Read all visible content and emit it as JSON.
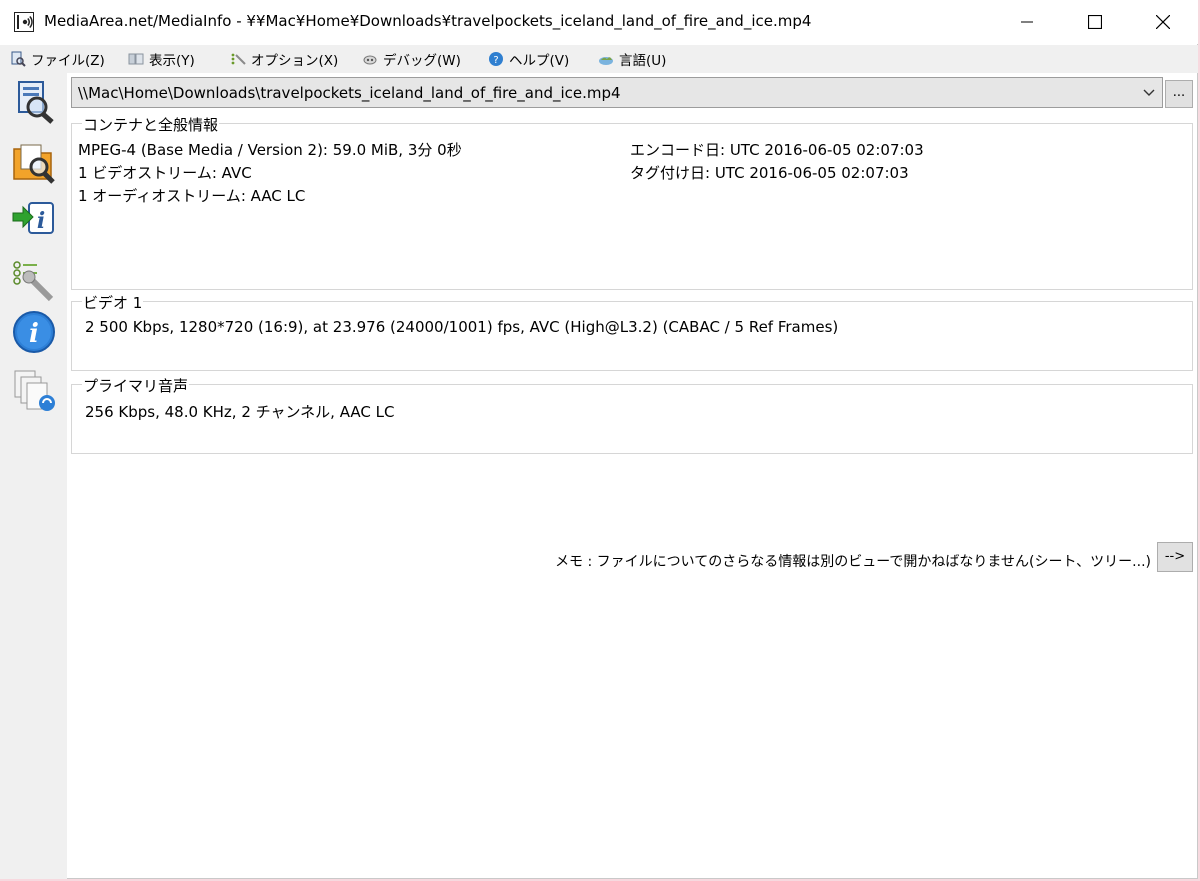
{
  "window": {
    "title": "MediaArea.net/MediaInfo - ¥¥Mac¥Home¥Downloads¥travelpockets_iceland_land_of_fire_and_ice.mp4"
  },
  "menu": {
    "items": [
      {
        "label": "ファイル(Z)",
        "icon": "file-icon"
      },
      {
        "label": "表示(Y)",
        "icon": "view-icon"
      },
      {
        "label": "オプション(X)",
        "icon": "options-icon"
      },
      {
        "label": "デバッグ(W)",
        "icon": "debug-icon"
      },
      {
        "label": "ヘルプ(V)",
        "icon": "help-icon"
      },
      {
        "label": "言語(U)",
        "icon": "language-icon"
      }
    ]
  },
  "toolbar": {
    "icons": [
      "open-file-icon",
      "open-folder-icon",
      "export-icon",
      "preferences-icon",
      "about-icon",
      "other-views-icon"
    ]
  },
  "file_select": {
    "value": "\\\\Mac\\Home\\Downloads\\travelpockets_iceland_land_of_fire_and_ice.mp4",
    "browse_label": "..."
  },
  "general": {
    "title": "コンテナと全般情報",
    "left_lines": [
      "MPEG-4 (Base Media / Version 2): 59.0 MiB, 3分 0秒",
      "1 ビデオストリーム: AVC",
      "1 オーディオストリーム: AAC LC"
    ],
    "right_lines": [
      "エンコード日: UTC 2016-06-05 02:07:03",
      "タグ付け日: UTC 2016-06-05 02:07:03"
    ]
  },
  "video": {
    "title": "ビデオ 1",
    "line": "2 500 Kbps, 1280*720 (16:9), at 23.976 (24000/1001) fps, AVC (High@L3.2) (CABAC / 5 Ref Frames)"
  },
  "audio": {
    "title": "プライマリ音声",
    "line": "256 Kbps, 48.0 KHz, 2 チャンネル, AAC LC"
  },
  "note": {
    "text": "メモ : ファイルについてのさらなる情報は別のビューで開かねばなりません(シート、ツリー...)",
    "button_label": "-->"
  }
}
